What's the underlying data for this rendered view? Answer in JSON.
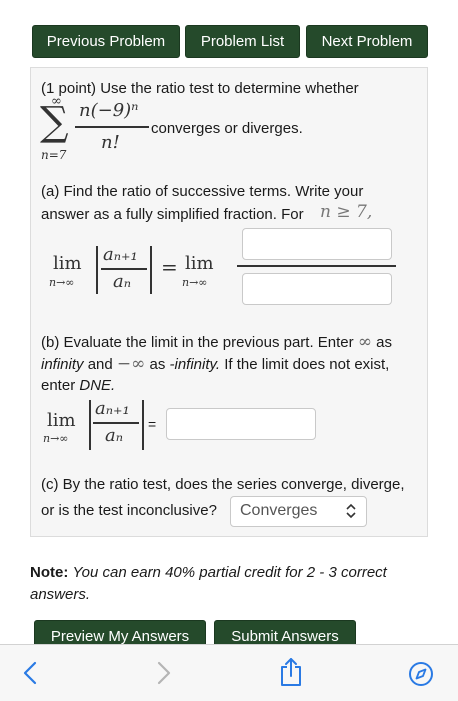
{
  "nav": {
    "previous": "Previous Problem",
    "list": "Problem List",
    "next": "Next Problem"
  },
  "problem": {
    "intro": "(1 point) Use the ratio test to determine whether",
    "sum_upper": "∞",
    "sum_symbol": "∑",
    "sum_lower": "n=7",
    "term_numerator": "n(−9)ⁿ",
    "term_denominator": "n!",
    "after_sum": "converges or diverges.",
    "part_a_line1": "(a) Find the ratio of successive terms. Write your",
    "part_a_line2": "answer as a fully simplified fraction. For",
    "part_a_condition": "n ≥ 7,",
    "lim_word": "lim",
    "lim_sub": "n→∞",
    "ratio_num": "aₙ₊₁",
    "ratio_den": "aₙ",
    "equals": "=",
    "part_b_line1_a": "(b) Evaluate the limit in the previous part. Enter",
    "part_b_inf_symbol": "∞",
    "part_b_line1_b": "as",
    "part_b_line2_a": "infinity",
    "part_b_line2_b": "and",
    "part_b_neg_inf_symbol": "−∞",
    "part_b_line2_c": "as",
    "part_b_line2_d": "-infinity.",
    "part_b_line2_e": "If the limit does not exist,",
    "part_b_line3_a": "enter",
    "part_b_line3_b": "DNE.",
    "part_c_line1": "(c) By the ratio test, does the series converge, diverge,",
    "part_c_line2": "or is the test inconclusive?",
    "part_c_selected": "Converges",
    "inputs": {
      "a_numerator": "",
      "a_denominator": "",
      "b_limit": ""
    }
  },
  "note": {
    "label": "Note:",
    "text": "You can earn 40% partial credit for 2 - 3 correct answers."
  },
  "actions": {
    "preview": "Preview My Answers",
    "submit": "Submit Answers"
  },
  "toolbar": {
    "back_icon": "chevron-left-icon",
    "forward_icon": "chevron-right-icon",
    "share_icon": "share-icon",
    "compass_icon": "compass-icon"
  },
  "colors": {
    "button_bg": "#254a2b",
    "panel_bg": "#f6f6f6",
    "accent_blue": "#2a7ae4"
  }
}
